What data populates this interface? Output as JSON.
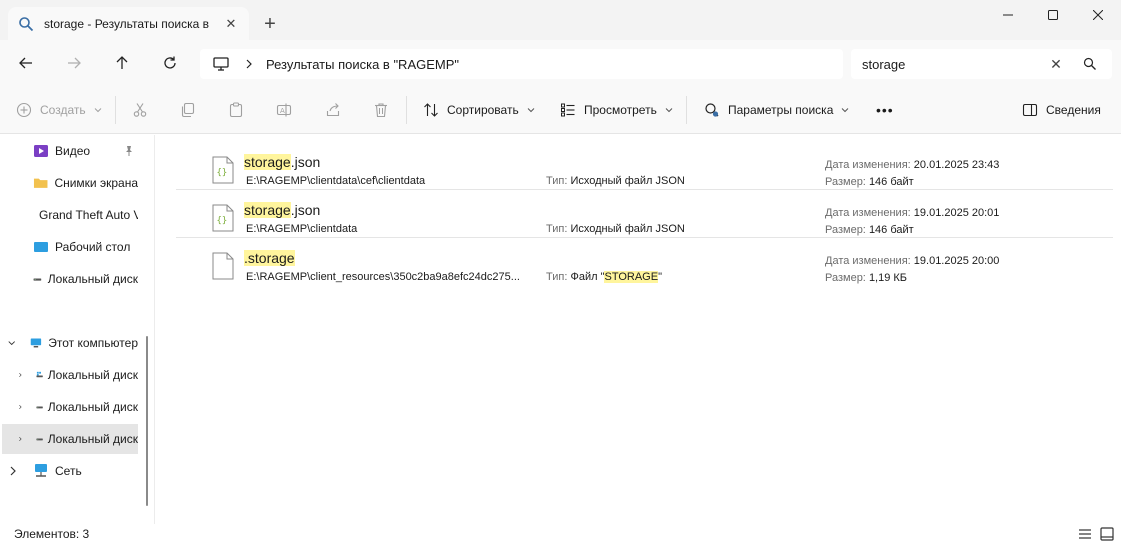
{
  "tab": {
    "title": "storage - Результаты поиска в",
    "icon": "search-icon"
  },
  "window": {
    "new_tab": "+",
    "controls": [
      "minimize-icon",
      "maximize-icon",
      "close-icon"
    ]
  },
  "nav": {
    "back": "arrow-left-icon",
    "forward": "arrow-right-icon",
    "up": "arrow-up-icon",
    "refresh": "refresh-icon"
  },
  "address": {
    "path": "Результаты поиска в \"RAGEMP\""
  },
  "search": {
    "value": "storage"
  },
  "toolbar": {
    "create_label": "Создать",
    "sort_label": "Сортировать",
    "view_label": "Просмотреть",
    "search_options_label": "Параметры поиска",
    "more_label": "•••",
    "details_label": "Сведения"
  },
  "sidebar": {
    "items": [
      {
        "label": "Видео",
        "icon": "video-folder-icon"
      },
      {
        "label": "Снимки экрана",
        "icon": "folder-icon"
      },
      {
        "label": "Grand Theft Auto V",
        "icon": "folder-icon"
      },
      {
        "label": "Рабочий стол",
        "icon": "desktop-folder-icon"
      },
      {
        "label": "Локальный диск",
        "icon": "drive-icon"
      },
      {
        "label": "Этот компьютер",
        "icon": "computer-icon"
      },
      {
        "label": "Локальный диск",
        "icon": "system-drive-icon"
      },
      {
        "label": "Локальный диск",
        "icon": "drive-icon"
      },
      {
        "label": "Локальный диск",
        "icon": "drive-icon"
      },
      {
        "label": "Сеть",
        "icon": "network-icon"
      }
    ]
  },
  "meta_labels": {
    "type": "Тип:",
    "modified": "Дата изменения:",
    "size": "Размер:"
  },
  "files": [
    {
      "name_hl": "storage",
      "name_rest": ".json",
      "path": "E:\\RAGEMP\\clientdata\\cef\\clientdata",
      "type": "Исходный файл JSON",
      "type_hl": "",
      "type_post": "",
      "modified": "20.01.2025 23:43",
      "size": "146 байт"
    },
    {
      "name_hl": "storage",
      "name_rest": ".json",
      "path": "E:\\RAGEMP\\clientdata",
      "type": "Исходный файл JSON",
      "type_hl": "",
      "type_post": "",
      "modified": "19.01.2025 20:01",
      "size": "146 байт"
    },
    {
      "name_hl": ".storage",
      "name_rest": "",
      "path": "E:\\RAGEMP\\client_resources\\350c2ba9a8efc24dc275...",
      "type": "Файл \"",
      "type_hl": "STORAGE",
      "type_post": "\"",
      "modified": "19.01.2025 20:00",
      "size": "1,19 КБ"
    }
  ],
  "status": {
    "count": "Элементов: 3"
  }
}
